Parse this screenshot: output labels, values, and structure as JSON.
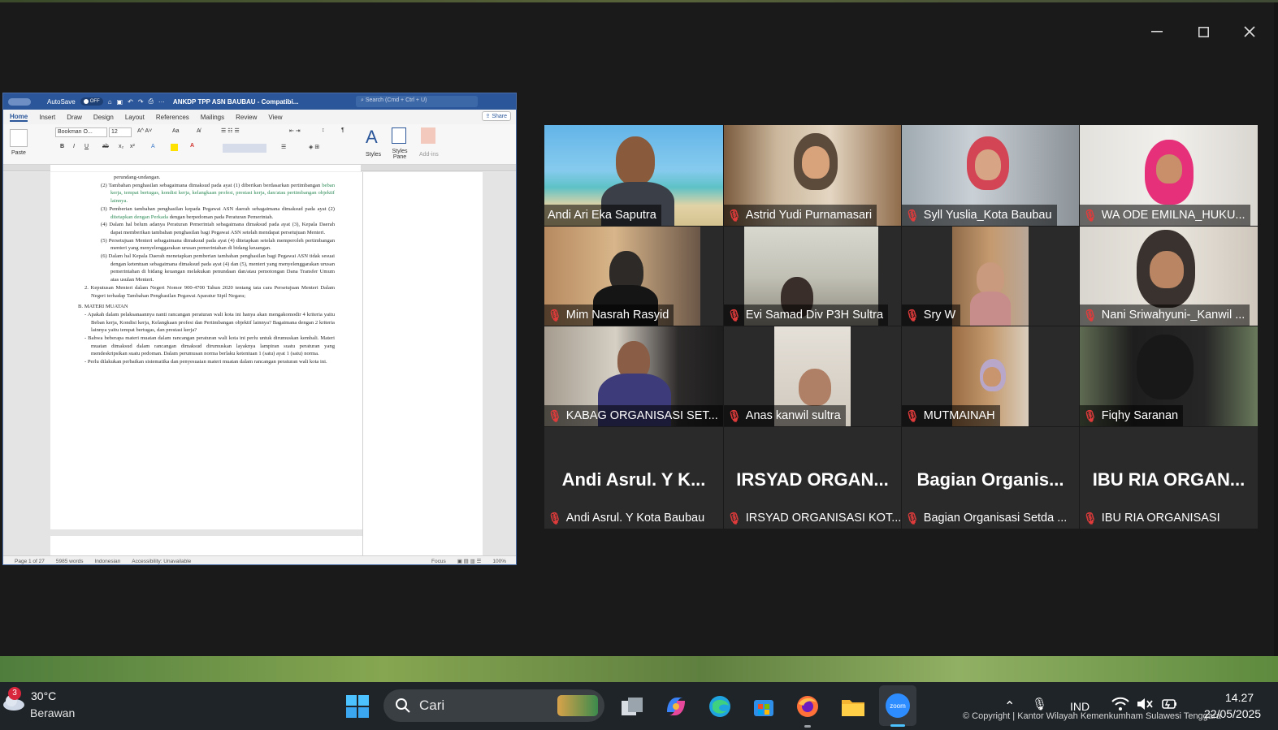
{
  "word": {
    "autosave_label": "AutoSave",
    "autosave_state": "OFF",
    "doc_title": "ANKDP TPP ASN BAUBAU  -  Compatibi...",
    "search_placeholder": "Search (Cmd + Ctrl + U)",
    "tabs": [
      "Home",
      "Insert",
      "Draw",
      "Design",
      "Layout",
      "References",
      "Mailings",
      "Review",
      "View"
    ],
    "share_label": "Share",
    "ribbon": {
      "paste": "Paste",
      "font_name": "Bookman O...",
      "font_size": "12",
      "styles": "Styles",
      "styles_pane": "Styles Pane",
      "addins": "Add-ins"
    },
    "body": {
      "l0": "perundang-undangan.",
      "p2a": "(2)  Tambahan penghasilan sebagaimana dimaksud pada ayat (1) diberikan berdasarkan pertimbangan ",
      "p2g": "beban kerja, tempat bertugas, kondisi kerja, kelangkaan profesi, prestasi kerja, dan/atau pertimbangan objektif lainnya.",
      "p3a": "(3)  Pemberian tambahan penghasilan kepada Pegawai ASN daerah sebagaimana dimaksud pada ayat (2) ",
      "p3g": "ditetapkan dengan Perkada",
      "p3b": " dengan berpedoman pada Peraturan Pemerintah.",
      "p4": "(4)  Dalam hal belum adanya Peraturan Pemerintah sebagaimana dimaksud pada ayat (3), Kepala Daerah dapat memberikan tambahan penghasilan bagi Pegawai ASN setelah mendapat persetujuan Menteri.",
      "p5": "(5)  Persetujuan Menteri sebagaimana dimaksud pada ayat (4) ditetapkan setelah memperoleh pertimbangan menteri yang menyelenggarakan urusan pemerintahan di bidang keuangan.",
      "p6": "(6)  Dalam hal Kepala Daerah menetapkan pemberian tambahan penghasilan bagi Pegawai ASN tidak sesuai dengan ketentuan sebagaimana dimaksud pada ayat (4) dan (5), menteri yang menyelenggarakan urusan pemerintahan di bidang keuangan melakukan penundaan dan/atau pemotongan Dana Transfer Umum atas usulan Menteri.",
      "i2": "2.  Keputusan Menteri dalam Negeri Nomor 900-4700 Tahun 2020 tentang tata cara Persetujuan Menteri Dalam Negeri terhadap Tambahan Penghasilan Pegawai Aparatur Sipil Negara;",
      "heading": "B.  MATERI MUATAN",
      "b1": "-  Apakah dalam pelaksanaannya nanti rancangan peraturan wali kota ini hanya akan mengakomodir 4 kriteria yaitu Beban kerja, Kondisi kerja, Kelangkaan profesi dan Pertimbangan objektif lainnya? Bagaimana dengan 2 kriteria lainnya yaitu tempat bertugas, dan prestasi kerja?",
      "b2": "-  Bahwa beberapa materi muatan dalam rancangan peraturan wali kota ini perlu untuk dirumuskan kembali. Materi muatan dimaksud dalam rancangan dimaksud dirumuskan layaknya lampiran suatu peraturan yang mendeskripsikan suatu pedoman. Dalam perumusan norma berlaku ketentuan 1 (satu) ayat 1 (satu) norma.",
      "b3": "-  Perlu dilakukan perbaikan sistematika dan penyesuaian materi muatan dalam rancangan peraturan wali kota ini."
    },
    "status": {
      "page": "Page 1 of 27",
      "words": "5985 words",
      "lang": "Indonesian",
      "accessibility": "Accessibility: Unavailable",
      "focus": "Focus",
      "zoom": "100%"
    }
  },
  "participants": [
    {
      "name": "Andi Ari Eka Saputra",
      "muted": false,
      "speaking": true
    },
    {
      "name": "Astrid Yudi Purnamasari",
      "muted": true
    },
    {
      "name": "Syll Yuslia_Kota Baubau",
      "muted": true
    },
    {
      "name": "WA ODE EMILNA_HUKU...",
      "muted": true
    },
    {
      "name": "Mim Nasrah Rasyid",
      "muted": true
    },
    {
      "name": "Evi Samad Div P3H Sultra",
      "muted": true
    },
    {
      "name": "Sry W",
      "muted": true
    },
    {
      "name": "Nani Sriwahyuni-_Kanwil ...",
      "muted": true
    },
    {
      "name": "KABAG ORGANISASI SET...",
      "muted": true
    },
    {
      "name": "Anas kanwil sultra",
      "muted": true
    },
    {
      "name": "MUTMAINAH",
      "muted": true
    },
    {
      "name": "Fiqhy Saranan",
      "muted": true
    },
    {
      "name": "Andi Asrul. Y Kota Baubau",
      "display": "Andi Asrul. Y K...",
      "muted": true
    },
    {
      "name": "IRSYAD ORGANISASI KOT...",
      "display": "IRSYAD ORGAN...",
      "muted": true
    },
    {
      "name": "Bagian Organisasi Setda ...",
      "display": "Bagian Organis...",
      "muted": true
    },
    {
      "name": "IBU RIA ORGANISASI",
      "display": "IBU RIA ORGAN...",
      "muted": true
    }
  ],
  "taskbar": {
    "weather_badge": "3",
    "temperature": "30°C",
    "condition": "Berawan",
    "search_label": "Cari",
    "language": "IND",
    "time": "14.27",
    "date": "22/05/2025"
  },
  "copyright": "© Copyright | Kantor Wilayah Kemenkumham Sulawesi Tenggara",
  "colors": {
    "accent_word": "#2b579a",
    "speaker_outline": "#27d260",
    "muted": "#e23b3b",
    "taskbar": "#1f2428"
  }
}
